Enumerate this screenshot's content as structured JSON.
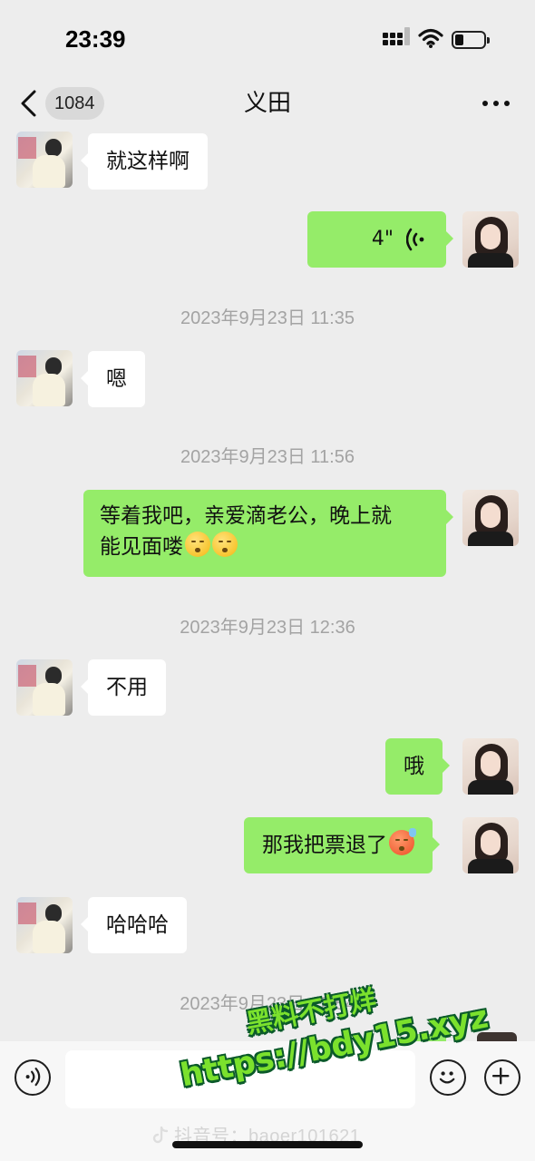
{
  "status_bar": {
    "time": "23:39"
  },
  "header": {
    "back_icon": "chevron-left-icon",
    "unread_count": "1084",
    "title": "义田",
    "more_icon": "more-dots-icon"
  },
  "messages": [
    {
      "side": "in",
      "text": "就这样啊"
    },
    {
      "side": "out",
      "type": "voice",
      "duration": "4\""
    },
    {
      "type": "timestamp",
      "text": "2023年9月23日 11:35"
    },
    {
      "side": "in",
      "text": "嗯"
    },
    {
      "type": "timestamp",
      "text": "2023年9月23日 11:56"
    },
    {
      "side": "out",
      "text_line1": "等着我吧，亲爱滴老公，晚上就",
      "text_line2": "能见面喽",
      "emoji": "kissing-face-emoji"
    },
    {
      "type": "timestamp",
      "text": "2023年9月23日 12:36"
    },
    {
      "side": "in",
      "text": "不用"
    },
    {
      "side": "out",
      "text": "哦"
    },
    {
      "side": "out",
      "text": "那我把票退了",
      "emoji": "angry-sweat-face-emoji"
    },
    {
      "side": "in",
      "text": "哈哈哈"
    },
    {
      "type": "timestamp",
      "text": "2023年9月23日 12:54"
    }
  ],
  "input_bar": {
    "voice_icon": "voice-input-icon",
    "emoji_icon": "emoji-icon",
    "plus_icon": "plus-icon"
  },
  "watermarks": {
    "promo_line1": "黑料不打烊",
    "promo_line2": "https://bdy15.xyz",
    "tiktok_text": "抖音号：baoer101621"
  },
  "colors": {
    "background": "#ededed",
    "outgoing_bubble": "#95ec69",
    "incoming_bubble": "#ffffff",
    "timestamp_text": "#a3a3a3"
  }
}
